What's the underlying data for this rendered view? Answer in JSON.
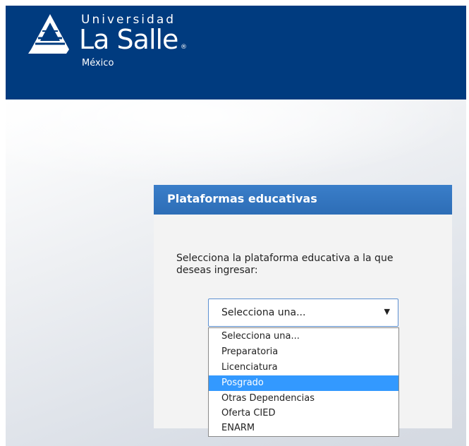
{
  "header": {
    "logo_top": "Universidad",
    "logo_name": "La Salle",
    "logo_registered": "®",
    "logo_country": "México",
    "background_color": "#003b7f"
  },
  "panel": {
    "title": "Plataformas educativas",
    "instruction": "Selecciona la plataforma educativa a la que deseas ingresar:",
    "header_color": "#2d6db6"
  },
  "select": {
    "value": "Selecciona una...",
    "arrow_icon": "triangle-down",
    "options": [
      "Selecciona una...",
      "Preparatoria",
      "Licenciatura",
      "Posgrado",
      "Otras Dependencias",
      "Oferta CIED",
      "ENARM"
    ],
    "highlighted": "Posgrado",
    "highlight_color": "#3399ff"
  }
}
